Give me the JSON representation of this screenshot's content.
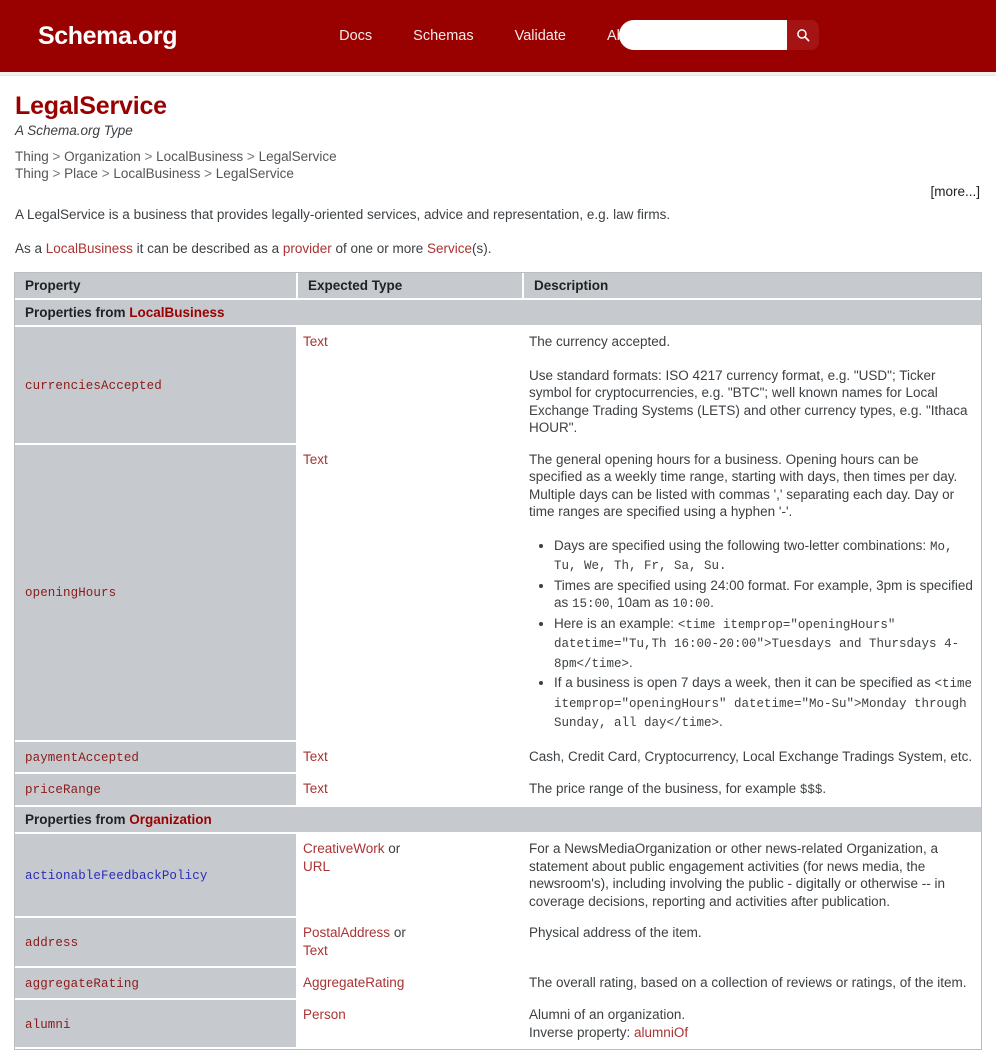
{
  "header": {
    "brand": "Schema.org",
    "nav": [
      {
        "label": "Docs"
      },
      {
        "label": "Schemas"
      },
      {
        "label": "Validate"
      },
      {
        "label": "About"
      }
    ],
    "search": {
      "value": "",
      "placeholder": "",
      "button_icon": "search-icon"
    },
    "background_color": "#990000"
  },
  "page": {
    "title": "LegalService",
    "subtitle": "A Schema.org Type",
    "breadcrumbs": [
      [
        "Thing",
        "Organization",
        "LocalBusiness",
        "LegalService"
      ],
      [
        "Thing",
        "Place",
        "LocalBusiness",
        "LegalService"
      ]
    ],
    "more_link": "[more...]",
    "description_1": "A LegalService is a business that provides legally-oriented services, advice and representation, e.g. law firms.",
    "description_2": {
      "prefix": "As a ",
      "link1": "LocalBusiness",
      "middle": " it can be described as a ",
      "link2": "provider",
      "middle2": " of one or more ",
      "link3": "Service",
      "suffix": "(s)."
    }
  },
  "table": {
    "columns": [
      "Property",
      "Expected Type",
      "Description"
    ],
    "sections": [
      {
        "label_prefix": "Properties from ",
        "label_link": "LocalBusiness",
        "rows": [
          {
            "property": "currenciesAccepted",
            "property_visited": false,
            "types": [
              "Text"
            ],
            "description_paragraphs": [
              "The currency accepted.",
              "Use standard formats: ISO 4217 currency format, e.g. \"USD\"; Ticker symbol for cryptocurrencies, e.g. \"BTC\"; well known names for Local Exchange Trading Systems (LETS) and other currency types, e.g. \"Ithaca HOUR\"."
            ],
            "description_links": [
              "ISO 4217",
              "Local Exchange Trading Systems"
            ]
          },
          {
            "property": "openingHours",
            "property_visited": false,
            "types": [
              "Text"
            ],
            "description_paragraphs": [
              "The general opening hours for a business. Opening hours can be specified as a weekly time range, starting with days, then times per day. Multiple days can be listed with commas ',' separating each day. Day or time ranges are specified using a hyphen '-'."
            ],
            "bullets": [
              {
                "text_before": "Days are specified using the following two-letter combinations: ",
                "code": "Mo, Tu, We, Th, Fr, Sa, Su.",
                "text_after": ""
              },
              {
                "text_before": "Times are specified using 24:00 format. For example, 3pm is specified as ",
                "code": "15:00",
                "text_mid": ", 10am as ",
                "code2": "10:00",
                "text_after": "."
              },
              {
                "text_before": "Here is an example: ",
                "code": "<time itemprop=\"openingHours\" datetime=\"Tu,Th 16:00-20:00\">Tuesdays and Thursdays 4-8pm</time>",
                "text_after": "."
              },
              {
                "text_before": "If a business is open 7 days a week, then it can be specified as ",
                "code": "<time itemprop=\"openingHours\" datetime=\"Mo-Su\">Monday through Sunday, all day</time>",
                "text_after": "."
              }
            ]
          },
          {
            "property": "paymentAccepted",
            "property_visited": false,
            "types": [
              "Text"
            ],
            "description_paragraphs": [
              "Cash, Credit Card, Cryptocurrency, Local Exchange Tradings System, etc."
            ]
          },
          {
            "property": "priceRange",
            "property_visited": false,
            "types": [
              "Text"
            ],
            "description_paragraphs": [
              "The price range of the business, for example "
            ],
            "description_code_tail": "$$$",
            "description_tail": "."
          }
        ]
      },
      {
        "label_prefix": "Properties from ",
        "label_link": "Organization",
        "rows": [
          {
            "property": "actionableFeedbackPolicy",
            "property_visited": true,
            "types": [
              "CreativeWork",
              "URL"
            ],
            "type_separator": "or",
            "description_paragraphs": [
              "For a NewsMediaOrganization or other news-related Organization, a statement about public engagement activities (for news media, the newsroom's), including involving the public - digitally or otherwise -- in coverage decisions, reporting and activities after publication."
            ],
            "description_links": [
              "NewsMediaOrganization",
              "Organization"
            ]
          },
          {
            "property": "address",
            "property_visited": false,
            "types": [
              "PostalAddress",
              "Text"
            ],
            "type_separator": "or",
            "description_paragraphs": [
              "Physical address of the item."
            ]
          },
          {
            "property": "aggregateRating",
            "property_visited": false,
            "types": [
              "AggregateRating"
            ],
            "description_paragraphs": [
              "The overall rating, based on a collection of reviews or ratings, of the item."
            ]
          },
          {
            "property": "alumni",
            "property_visited": false,
            "types": [
              "Person"
            ],
            "description_paragraphs": [
              "Alumni of an organization."
            ],
            "inverse_label": "Inverse property: ",
            "inverse_link": "alumniOf"
          }
        ]
      }
    ]
  }
}
